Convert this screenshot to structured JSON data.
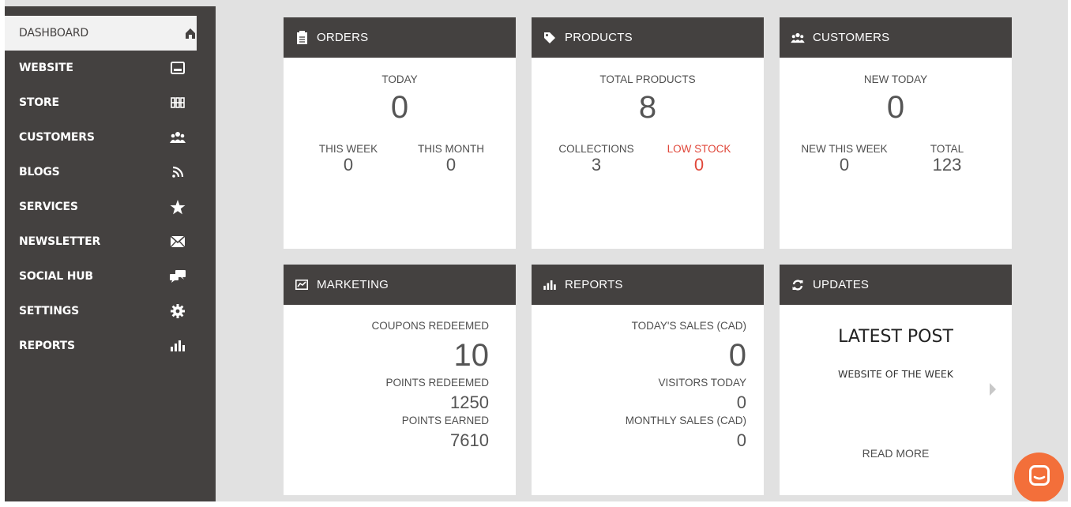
{
  "sidebar": {
    "items": [
      {
        "label": "DASHBOARD",
        "icon": "home-icon"
      },
      {
        "label": "WEBSITE",
        "icon": "browser-window-icon"
      },
      {
        "label": "STORE",
        "icon": "store-grid-icon"
      },
      {
        "label": "CUSTOMERS",
        "icon": "users-icon"
      },
      {
        "label": "BLOGS",
        "icon": "rss-icon"
      },
      {
        "label": "SERVICES",
        "icon": "star-icon"
      },
      {
        "label": "NEWSLETTER",
        "icon": "envelope-icon"
      },
      {
        "label": "SOCIAL HUB",
        "icon": "chat-bubbles-icon"
      },
      {
        "label": "SETTINGS",
        "icon": "gear-icon"
      },
      {
        "label": "REPORTS",
        "icon": "bar-chart-icon"
      }
    ]
  },
  "orders": {
    "title": "ORDERS",
    "today_label": "TODAY",
    "today_value": "0",
    "week_label": "THIS WEEK",
    "week_value": "0",
    "month_label": "THIS MONTH",
    "month_value": "0"
  },
  "products": {
    "title": "PRODUCTS",
    "total_label": "TOTAL PRODUCTS",
    "total_value": "8",
    "collections_label": "COLLECTIONS",
    "collections_value": "3",
    "low_stock_label": "LOW STOCK",
    "low_stock_value": "0"
  },
  "customers": {
    "title": "CUSTOMERS",
    "new_today_label": "NEW TODAY",
    "new_today_value": "0",
    "new_week_label": "NEW THIS WEEK",
    "new_week_value": "0",
    "total_label": "TOTAL",
    "total_value": "123"
  },
  "marketing": {
    "title": "MARKETING",
    "coupons_label": "COUPONS REDEEMED",
    "coupons_value": "10",
    "points_redeemed_label": "POINTS REDEEMED",
    "points_redeemed_value": "1250",
    "points_earned_label": "POINTS EARNED",
    "points_earned_value": "7610"
  },
  "reports": {
    "title": "REPORTS",
    "todays_sales_label": "TODAY'S SALES (CAD)",
    "todays_sales_value": "0",
    "visitors_label": "VISITORS TODAY",
    "visitors_value": "0",
    "monthly_sales_label": "MONTHLY SALES (CAD)",
    "monthly_sales_value": "0"
  },
  "updates": {
    "title": "UPDATES",
    "latest_post": "LATEST POST",
    "post_title": "WEBSITE OF THE WEEK",
    "read_more": "READ MORE"
  },
  "colors": {
    "sidebar": "#444140",
    "accent_red": "#e0473a",
    "chat": "#f36f3a",
    "background": "#e1e1e1"
  }
}
